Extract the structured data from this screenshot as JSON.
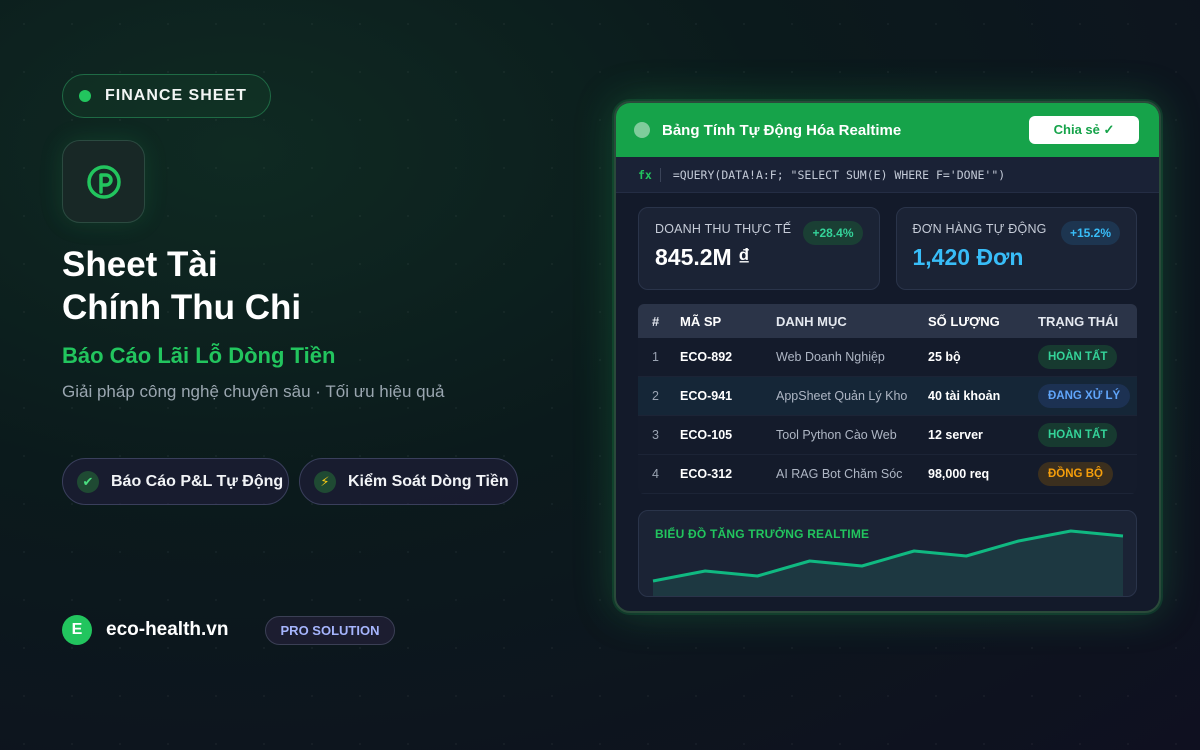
{
  "left": {
    "badge": "FINANCE SHEET",
    "headline_line1": "Sheet Tài",
    "headline_line2": "Chính Thu Chi",
    "subheadline": "Báo Cáo Lãi Lỗ Dòng Tiền",
    "tagline": "Giải pháp công nghệ chuyên sâu · Tối ưu hiệu quả",
    "features": [
      {
        "icon": "check-icon",
        "label": "Báo Cáo P&L Tự Động"
      },
      {
        "icon": "lightning-icon",
        "label": "Kiểm Soát Dòng Tiền"
      }
    ],
    "brand_letter": "E",
    "brand_name": "eco-health.vn",
    "pro_label": "PRO SOLUTION"
  },
  "window": {
    "title": "Bảng Tính Tự Động Hóa Realtime",
    "share_button": "Chia sẻ ✓",
    "fx_label": "fx",
    "formula": "=QUERY(DATA!A:F; \"SELECT SUM(E) WHERE F='DONE'\")",
    "kpis": [
      {
        "label": "DOANH THU THỰC TẾ",
        "value": "845.2M ₫",
        "badge": "+28.4%"
      },
      {
        "label": "ĐƠN HÀNG TỰ ĐỘNG",
        "value": "1,420 Đơn",
        "badge": "+15.2%"
      }
    ],
    "table": {
      "headers": [
        "#",
        "MÃ SP",
        "DANH MỤC",
        "SỐ LƯỢNG",
        "TRẠNG THÁI"
      ],
      "rows": [
        {
          "num": "1",
          "code": "ECO-892",
          "category": "Web Doanh Nghiệp",
          "qty": "25 bộ",
          "status": "HOÀN TẤT"
        },
        {
          "num": "2",
          "code": "ECO-941",
          "category": "AppSheet Quản Lý Kho",
          "qty": "40 tài khoản",
          "status": "ĐANG XỬ LÝ"
        },
        {
          "num": "3",
          "code": "ECO-105",
          "category": "Tool Python Cào Web",
          "qty": "12 server",
          "status": "HOÀN TẤT"
        },
        {
          "num": "4",
          "code": "ECO-312",
          "category": "AI RAG Bot Chăm Sóc",
          "qty": "98,000 req",
          "status": "ĐỒNG BỘ"
        }
      ]
    },
    "chart_title": "BIỂU ĐỒ TĂNG TRƯỞNG REALTIME"
  },
  "colors": {
    "accent_green": "#22c55e",
    "kpi_blue": "#38bdf8",
    "status_green": "#34d399",
    "status_blue": "#60a5fa",
    "status_orange": "#f59e0b"
  },
  "chart_data": {
    "type": "area",
    "values": [
      2,
      4,
      3,
      6,
      5,
      8,
      7,
      10,
      12,
      11
    ],
    "title": "BIỂU ĐỒ TĂNG TRƯỞNG REALTIME"
  }
}
